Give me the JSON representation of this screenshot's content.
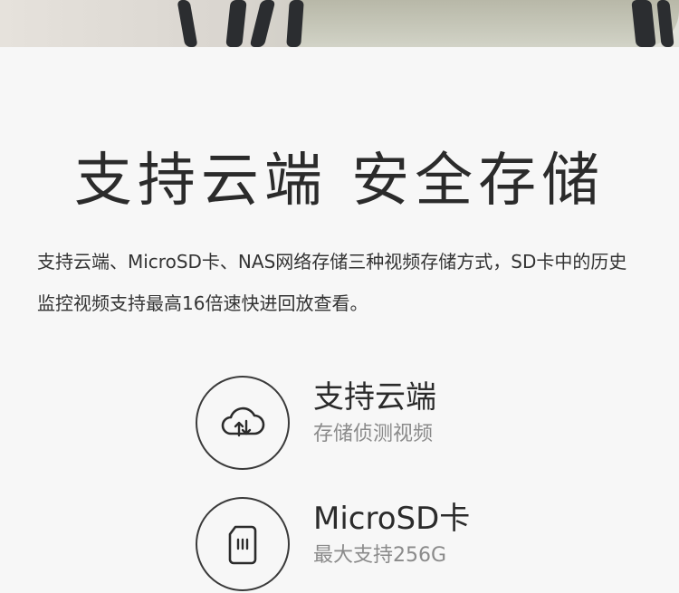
{
  "main_title": "支持云端  安全存储",
  "description": "支持云端、MicroSD卡、NAS网络存储三种视频存储方式，SD卡中的历史监控视频支持最高16倍速快进回放查看。",
  "features": [
    {
      "title": "支持云端",
      "subtitle": "存储侦测视频",
      "icon": "cloud-sync-icon"
    },
    {
      "title": "MicroSD卡",
      "subtitle": "最大支持256G",
      "icon": "sd-card-icon"
    }
  ]
}
